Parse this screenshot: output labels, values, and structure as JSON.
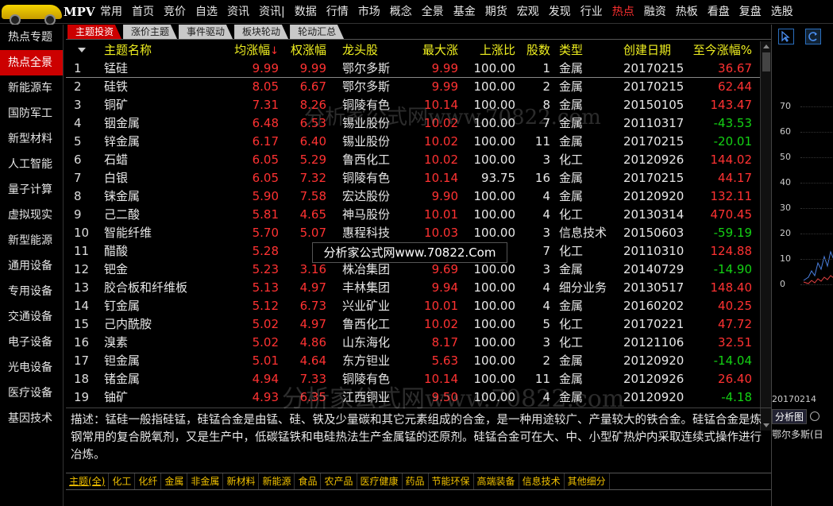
{
  "app": {
    "logo_text": "MPV"
  },
  "menu": [
    {
      "label": "常用"
    },
    {
      "label": "首页"
    },
    {
      "label": "竞价"
    },
    {
      "label": "自选"
    },
    {
      "label": "资讯"
    },
    {
      "label": "资讯|"
    },
    {
      "label": "数据"
    },
    {
      "label": "行情"
    },
    {
      "label": "市场"
    },
    {
      "label": "概念"
    },
    {
      "label": "全景"
    },
    {
      "label": "基金"
    },
    {
      "label": "期货"
    },
    {
      "label": "宏观"
    },
    {
      "label": "发现"
    },
    {
      "label": "行业"
    },
    {
      "label": "热点",
      "active": true
    },
    {
      "label": "融资"
    },
    {
      "label": "热板"
    },
    {
      "label": "看盘"
    },
    {
      "label": "复盘"
    },
    {
      "label": "选股"
    }
  ],
  "sidebar": [
    {
      "label": "热点专题"
    },
    {
      "label": "热点全景",
      "active": true
    },
    {
      "label": "新能源车"
    },
    {
      "label": "国防军工"
    },
    {
      "label": "新型材料"
    },
    {
      "label": "人工智能"
    },
    {
      "label": "量子计算"
    },
    {
      "label": "虚拟现实"
    },
    {
      "label": "新型能源"
    },
    {
      "label": "通用设备"
    },
    {
      "label": "专用设备"
    },
    {
      "label": "交通设备"
    },
    {
      "label": "电子设备"
    },
    {
      "label": "光电设备"
    },
    {
      "label": "医疗设备"
    },
    {
      "label": "基因技术"
    }
  ],
  "tabs": [
    {
      "label": "主题投资",
      "active": true
    },
    {
      "label": "涨价主题"
    },
    {
      "label": "事件驱动"
    },
    {
      "label": "板块轮动"
    },
    {
      "label": "轮动汇总"
    }
  ],
  "table": {
    "headers": {
      "name": "主题名称",
      "avg": "均涨幅",
      "avg_arrow": "↓",
      "wgt": "权涨幅",
      "lead": "龙头股",
      "max": "最大涨",
      "ratio": "上涨比",
      "cnt": "股数",
      "type": "类型",
      "date": "创建日期",
      "pct": "至今涨幅%"
    },
    "rows": [
      {
        "idx": "1",
        "name": "锰硅",
        "avg": "9.99",
        "wgt": "9.99",
        "lead": "鄂尔多斯",
        "max": "9.99",
        "ratio": "100.00",
        "cnt": "1",
        "type": "金属",
        "date": "20170215",
        "pct": "36.67",
        "pct_dir": "up"
      },
      {
        "idx": "2",
        "name": "硅铁",
        "avg": "8.05",
        "wgt": "6.67",
        "lead": "鄂尔多斯",
        "max": "9.99",
        "ratio": "100.00",
        "cnt": "2",
        "type": "金属",
        "date": "20170215",
        "pct": "62.44",
        "pct_dir": "up"
      },
      {
        "idx": "3",
        "name": "铜矿",
        "avg": "7.31",
        "wgt": "8.26",
        "lead": "铜陵有色",
        "max": "10.14",
        "ratio": "100.00",
        "cnt": "8",
        "type": "金属",
        "date": "20150105",
        "pct": "143.47",
        "pct_dir": "up"
      },
      {
        "idx": "4",
        "name": "铟金属",
        "avg": "6.48",
        "wgt": "6.53",
        "lead": "锡业股份",
        "max": "10.02",
        "ratio": "100.00",
        "cnt": "7",
        "type": "金属",
        "date": "20110317",
        "pct": "-43.53",
        "pct_dir": "down"
      },
      {
        "idx": "5",
        "name": "锌金属",
        "avg": "6.17",
        "wgt": "6.40",
        "lead": "锡业股份",
        "max": "10.02",
        "ratio": "100.00",
        "cnt": "11",
        "type": "金属",
        "date": "20170215",
        "pct": "-20.01",
        "pct_dir": "down"
      },
      {
        "idx": "6",
        "name": "石蜡",
        "avg": "6.05",
        "wgt": "5.29",
        "lead": "鲁西化工",
        "max": "10.02",
        "ratio": "100.00",
        "cnt": "3",
        "type": "化工",
        "date": "20120926",
        "pct": "144.02",
        "pct_dir": "up"
      },
      {
        "idx": "7",
        "name": "白银",
        "avg": "6.05",
        "wgt": "7.32",
        "lead": "铜陵有色",
        "max": "10.14",
        "ratio": "93.75",
        "cnt": "16",
        "type": "金属",
        "date": "20170215",
        "pct": "44.17",
        "pct_dir": "up"
      },
      {
        "idx": "8",
        "name": "铼金属",
        "avg": "5.90",
        "wgt": "7.58",
        "lead": "宏达股份",
        "max": "9.90",
        "ratio": "100.00",
        "cnt": "4",
        "type": "金属",
        "date": "20120920",
        "pct": "132.11",
        "pct_dir": "up"
      },
      {
        "idx": "9",
        "name": "己二酸",
        "avg": "5.81",
        "wgt": "4.65",
        "lead": "神马股份",
        "max": "10.01",
        "ratio": "100.00",
        "cnt": "4",
        "type": "化工",
        "date": "20130314",
        "pct": "470.45",
        "pct_dir": "up"
      },
      {
        "idx": "10",
        "name": "智能纤维",
        "avg": "5.70",
        "wgt": "5.07",
        "lead": "惠程科技",
        "max": "10.03",
        "ratio": "100.00",
        "cnt": "3",
        "type": "信息技术",
        "date": "20150603",
        "pct": "-59.19",
        "pct_dir": "down"
      },
      {
        "idx": "11",
        "name": "醋酸",
        "avg": "5.28",
        "wgt": "4.",
        "lead": "",
        "max": "",
        "ratio": "",
        "cnt": "7",
        "type": "化工",
        "date": "20110310",
        "pct": "124.88",
        "pct_dir": "up"
      },
      {
        "idx": "12",
        "name": "钯金",
        "avg": "5.23",
        "wgt": "3.16",
        "lead": "株冶集团",
        "max": "9.69",
        "ratio": "100.00",
        "cnt": "3",
        "type": "金属",
        "date": "20140729",
        "pct": "-14.90",
        "pct_dir": "down"
      },
      {
        "idx": "13",
        "name": "胶合板和纤维板",
        "avg": "5.13",
        "wgt": "4.97",
        "lead": "丰林集团",
        "max": "9.94",
        "ratio": "100.00",
        "cnt": "4",
        "type": "细分业务",
        "date": "20130517",
        "pct": "148.40",
        "pct_dir": "up"
      },
      {
        "idx": "14",
        "name": "钉金属",
        "avg": "5.12",
        "wgt": "6.73",
        "lead": "兴业矿业",
        "max": "10.01",
        "ratio": "100.00",
        "cnt": "4",
        "type": "金属",
        "date": "20160202",
        "pct": "40.25",
        "pct_dir": "up"
      },
      {
        "idx": "15",
        "name": "己内酰胺",
        "avg": "5.02",
        "wgt": "4.97",
        "lead": "鲁西化工",
        "max": "10.02",
        "ratio": "100.00",
        "cnt": "5",
        "type": "化工",
        "date": "20170221",
        "pct": "47.72",
        "pct_dir": "up"
      },
      {
        "idx": "16",
        "name": "溴素",
        "avg": "5.02",
        "wgt": "4.86",
        "lead": "山东海化",
        "max": "8.17",
        "ratio": "100.00",
        "cnt": "3",
        "type": "化工",
        "date": "20121106",
        "pct": "32.51",
        "pct_dir": "up"
      },
      {
        "idx": "17",
        "name": "钽金属",
        "avg": "5.01",
        "wgt": "4.64",
        "lead": "东方钽业",
        "max": "5.63",
        "ratio": "100.00",
        "cnt": "2",
        "type": "金属",
        "date": "20120920",
        "pct": "-14.04",
        "pct_dir": "down"
      },
      {
        "idx": "18",
        "name": "锗金属",
        "avg": "4.94",
        "wgt": "7.33",
        "lead": "铜陵有色",
        "max": "10.14",
        "ratio": "100.00",
        "cnt": "11",
        "type": "金属",
        "date": "20120926",
        "pct": "26.40",
        "pct_dir": "up"
      },
      {
        "idx": "19",
        "name": "铀矿",
        "avg": "4.93",
        "wgt": "6.35",
        "lead": "江西铜业",
        "max": "9.50",
        "ratio": "100.00",
        "cnt": "4",
        "type": "金属",
        "date": "20120920",
        "pct": "-4.18",
        "pct_dir": "down"
      }
    ]
  },
  "description": "描述：锰硅一般指硅锰，硅锰合金是由锰、硅、铁及少量碳和其它元素组成的合金，是一种用途较广、产量较大的铁合金。硅锰合金是炼钢常用的复合脱氧剂，又是生产中，低碳锰铁和电硅热法生产金属锰的还原剂。硅锰合金可在大、中、小型矿热炉内采取连续式操作进行冶炼。",
  "categories": [
    {
      "label": "主题(全)",
      "active": true
    },
    {
      "label": "化工"
    },
    {
      "label": "化纤"
    },
    {
      "label": "金属"
    },
    {
      "label": "非金属"
    },
    {
      "label": "新材料"
    },
    {
      "label": "新能源"
    },
    {
      "label": "食品"
    },
    {
      "label": "农产品"
    },
    {
      "label": "医疗健康"
    },
    {
      "label": "药品"
    },
    {
      "label": "节能环保"
    },
    {
      "label": "高端装备"
    },
    {
      "label": "信息技术"
    },
    {
      "label": "其他细分"
    }
  ],
  "watermark": {
    "top": "分析家公式网www.70822.com",
    "banner": "分析家公式网www.70822.Com",
    "bottom": "分析家公式网www.70822.com"
  },
  "right_panel": {
    "axis": [
      "70",
      "60",
      "50",
      "40",
      "30",
      "20",
      "10",
      "0"
    ],
    "date": "20170214",
    "tab": "分析图",
    "stock": "鄂尔多斯(日"
  },
  "colors": {
    "up": "#ff3232",
    "down": "#14d214",
    "accent": "#cc0000"
  }
}
